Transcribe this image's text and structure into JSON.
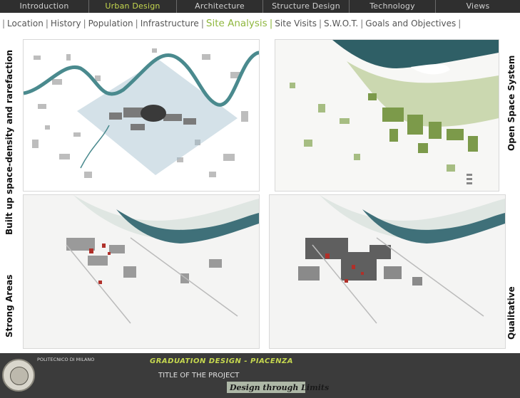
{
  "topnav": {
    "tabs": [
      {
        "label": "Introduction",
        "active": false
      },
      {
        "label": "Urban Design",
        "active": true
      },
      {
        "label": "Architecture",
        "active": false
      },
      {
        "label": "Structure Design",
        "active": false
      },
      {
        "label": "Technology",
        "active": false
      },
      {
        "label": "Views",
        "active": false
      }
    ]
  },
  "subnav": {
    "items": [
      {
        "label": "Location",
        "active": false
      },
      {
        "label": "History",
        "active": false
      },
      {
        "label": "Population",
        "active": false
      },
      {
        "label": "Infrastructure",
        "active": false
      },
      {
        "label": "Site Analysis",
        "active": true
      },
      {
        "label": "Site Visits",
        "active": false
      },
      {
        "label": "S.W.O.T.",
        "active": false
      },
      {
        "label": "Goals and Objectives",
        "active": false
      }
    ],
    "separator": "|"
  },
  "panels": {
    "top_left_label": "Built up space-density and rarefaction",
    "top_right_label": "Open Space System",
    "bottom_left_label": "Strong Areas",
    "bottom_right_label": "Qualitative"
  },
  "colors": {
    "river": "#4a8a8e",
    "river_dark": "#2f5f66",
    "green": "#7c9a4a",
    "accent": "#8fb73e",
    "red": "#b0302a"
  },
  "footer": {
    "university": "POLITECNICO DI MILANO",
    "project": "GRADUATION DESIGN - PIACENZA",
    "title": "TITLE OF THE PROJECT",
    "motto": "Design through Limits"
  }
}
